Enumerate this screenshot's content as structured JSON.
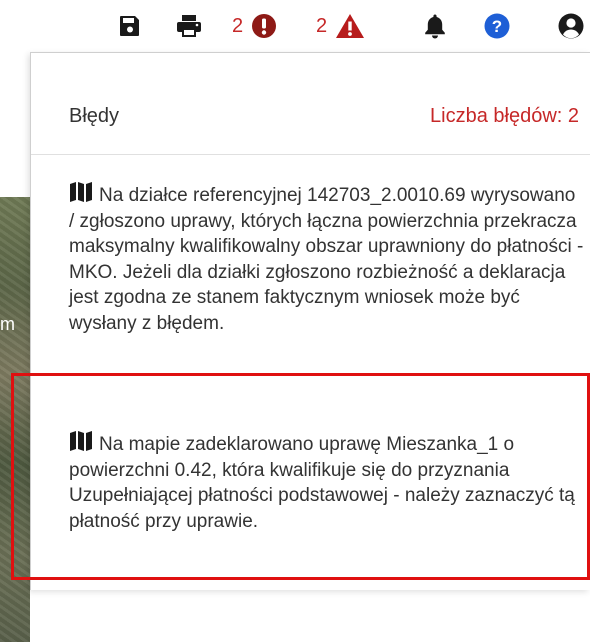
{
  "toolbar": {
    "icons": [
      "save-icon",
      "print-icon",
      "error-circle-icon",
      "warning-triangle-icon",
      "bell-icon",
      "help-icon",
      "user-icon"
    ],
    "error_count": "2",
    "warning_count": "2",
    "colors": {
      "error": "#c62828",
      "icon": "#1a1a1a",
      "help": "#1e5fd6"
    }
  },
  "map": {
    "visible_letter": "m"
  },
  "panel": {
    "title": "Błędy",
    "count_label": "Liczba błędów: 2",
    "messages": [
      {
        "icon": "map-icon",
        "text": "Na działce referencyjnej 142703_2.0010.69 wyrysowano / zgłoszono uprawy, których łączna powierzchnia przekracza maksymalny kwalifikowalny obszar uprawniony do płatności - MKO. Jeżeli dla działki zgłoszono rozbieżność a deklaracja jest zgodna ze stanem faktycznym wniosek może być wysłany z błędem."
      },
      {
        "icon": "map-icon",
        "text": "Na mapie zadeklarowano uprawę Mieszanka_1 o powierzchni 0.42, która kwalifikuje się do przyznania Uzupełniającej płatności podstawowej - należy zaznaczyć tą płatność przy uprawie."
      }
    ]
  },
  "highlight": {
    "color": "#e01010"
  }
}
